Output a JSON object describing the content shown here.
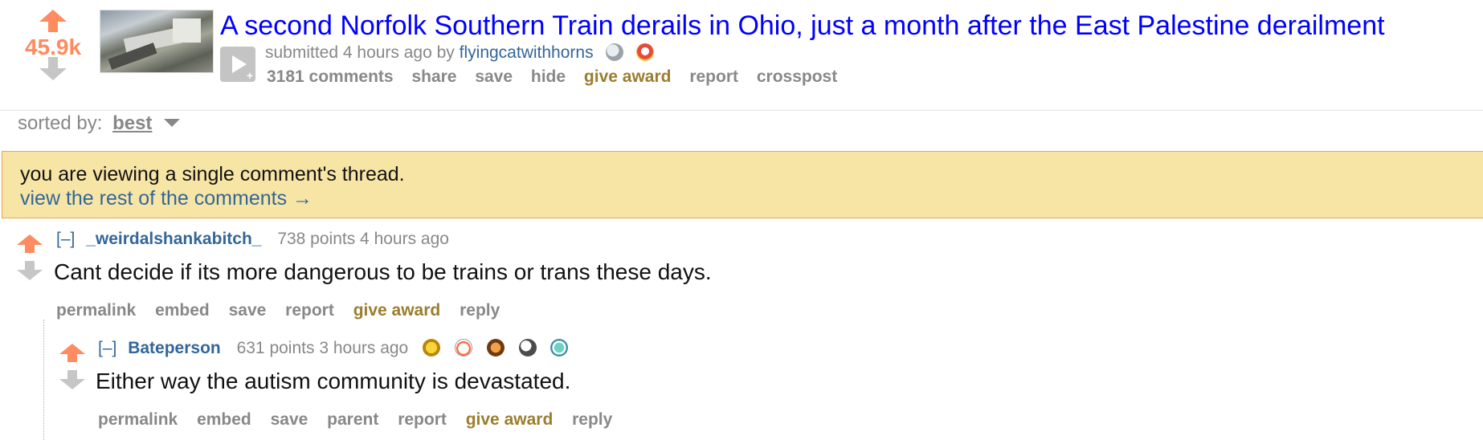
{
  "post": {
    "score": "45.9k",
    "title": "A second Norfolk Southern Train derails in Ohio, just a month after the East Palestine derailment",
    "submitted_prefix": "submitted 4 hours ago by",
    "author": "flyingcatwithhorns",
    "buttons": {
      "comments": "3181 comments",
      "share": "share",
      "save": "save",
      "hide": "hide",
      "give_award": "give award",
      "report": "report",
      "crosspost": "crosspost"
    },
    "icons": [
      "upvote-arrow",
      "downvote-arrow",
      "thumbnail",
      "expando-play",
      "award-silver",
      "award-helpful"
    ]
  },
  "sort": {
    "label": "sorted by:",
    "value": "best"
  },
  "infobar": {
    "line1": "you are viewing a single comment's thread.",
    "line2": "view the rest of the comments →"
  },
  "comments": [
    {
      "toggle": "[–]",
      "user": "_weirdalshankabitch_",
      "points_time": "738 points 4 hours ago",
      "body": "Cant decide if its more dangerous to be trains or trans these days.",
      "buttons": [
        "permalink",
        "embed",
        "save",
        "report",
        "give award",
        "reply"
      ]
    },
    {
      "toggle": "[–]",
      "user": "Bateperson",
      "points_time": "631 points 3 hours ago",
      "body": "Either way the autism community is devastated.",
      "buttons": [
        "permalink",
        "embed",
        "save",
        "parent",
        "report",
        "give award",
        "reply"
      ]
    }
  ],
  "colors": {
    "upvote": "#ff8b60",
    "downvote": "#c6c6c6",
    "link": "#0000ff",
    "user": "#336699",
    "award_text": "#9a7d2e",
    "infobar_bg": "#f7e5a6",
    "infobar_border": "#f0a24a"
  }
}
